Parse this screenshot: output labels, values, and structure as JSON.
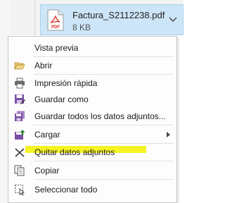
{
  "attachment": {
    "filename": "Factura_S2112238.pdf",
    "size": "8 KB",
    "icon": "pdf-file-icon",
    "icon_text": "PDF"
  },
  "context_menu": {
    "items": [
      {
        "label": "Vista previa",
        "icon": ""
      },
      {
        "label": "Abrir",
        "icon": "folder-open-icon"
      },
      {
        "label": "Impresión rápida",
        "icon": "printer-icon"
      },
      {
        "label": "Guardar como",
        "icon": "save-as-icon"
      },
      {
        "label": "Guardar todos los datos adjuntos...",
        "icon": "save-all-icon"
      },
      {
        "label": "Cargar",
        "icon": "upload-icon",
        "has_submenu": true
      },
      {
        "label": "Quitar datos adjuntos",
        "icon": "remove-x-icon"
      },
      {
        "label": "Copiar",
        "icon": "copy-icon"
      },
      {
        "label": "Seleccionar todo",
        "icon": "select-all-icon"
      }
    ]
  },
  "annotations": {
    "highlight_color": "#f5f20c",
    "highlighted_item": "Quitar datos adjuntos"
  },
  "colors": {
    "attachment_bg": "#cde6f7",
    "menu_bg": "#fdfdfd",
    "menu_border": "#c6c6c6"
  }
}
